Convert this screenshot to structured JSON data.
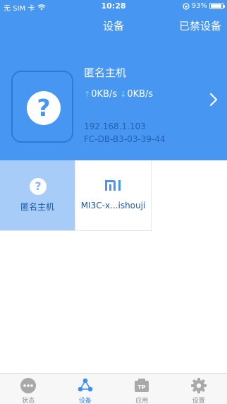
{
  "status_bar": {
    "carrier": "无 SIM 卡",
    "time": "10:28",
    "battery_percent": "93%",
    "battery_level": 0.93
  },
  "nav": {
    "title": "设备",
    "right_action": "已禁设备"
  },
  "device": {
    "name": "匿名主机",
    "upload_speed": "0KB/s",
    "download_speed": "0KB/s",
    "ip": "192.168.1.103",
    "mac": "FC-DB-B3-03-39-44",
    "icon": "question-icon"
  },
  "device_list": [
    {
      "label": "匿名主机",
      "icon": "question-icon",
      "selected": true
    },
    {
      "label": "MI3C-x...ishouji",
      "icon": "mi-logo-icon",
      "selected": false
    }
  ],
  "colors": {
    "primary": "#4696f2",
    "selected_tile": "#a8ccf8",
    "tab_active": "#3d8ef0",
    "tab_inactive": "#8c8c8c"
  },
  "tabs": [
    {
      "label": "状态",
      "icon": "status-dots-icon",
      "active": false
    },
    {
      "label": "设备",
      "icon": "devices-icon",
      "active": true
    },
    {
      "label": "应用",
      "icon": "tp-apps-icon",
      "active": false
    },
    {
      "label": "设置",
      "icon": "gear-icon",
      "active": false
    }
  ]
}
